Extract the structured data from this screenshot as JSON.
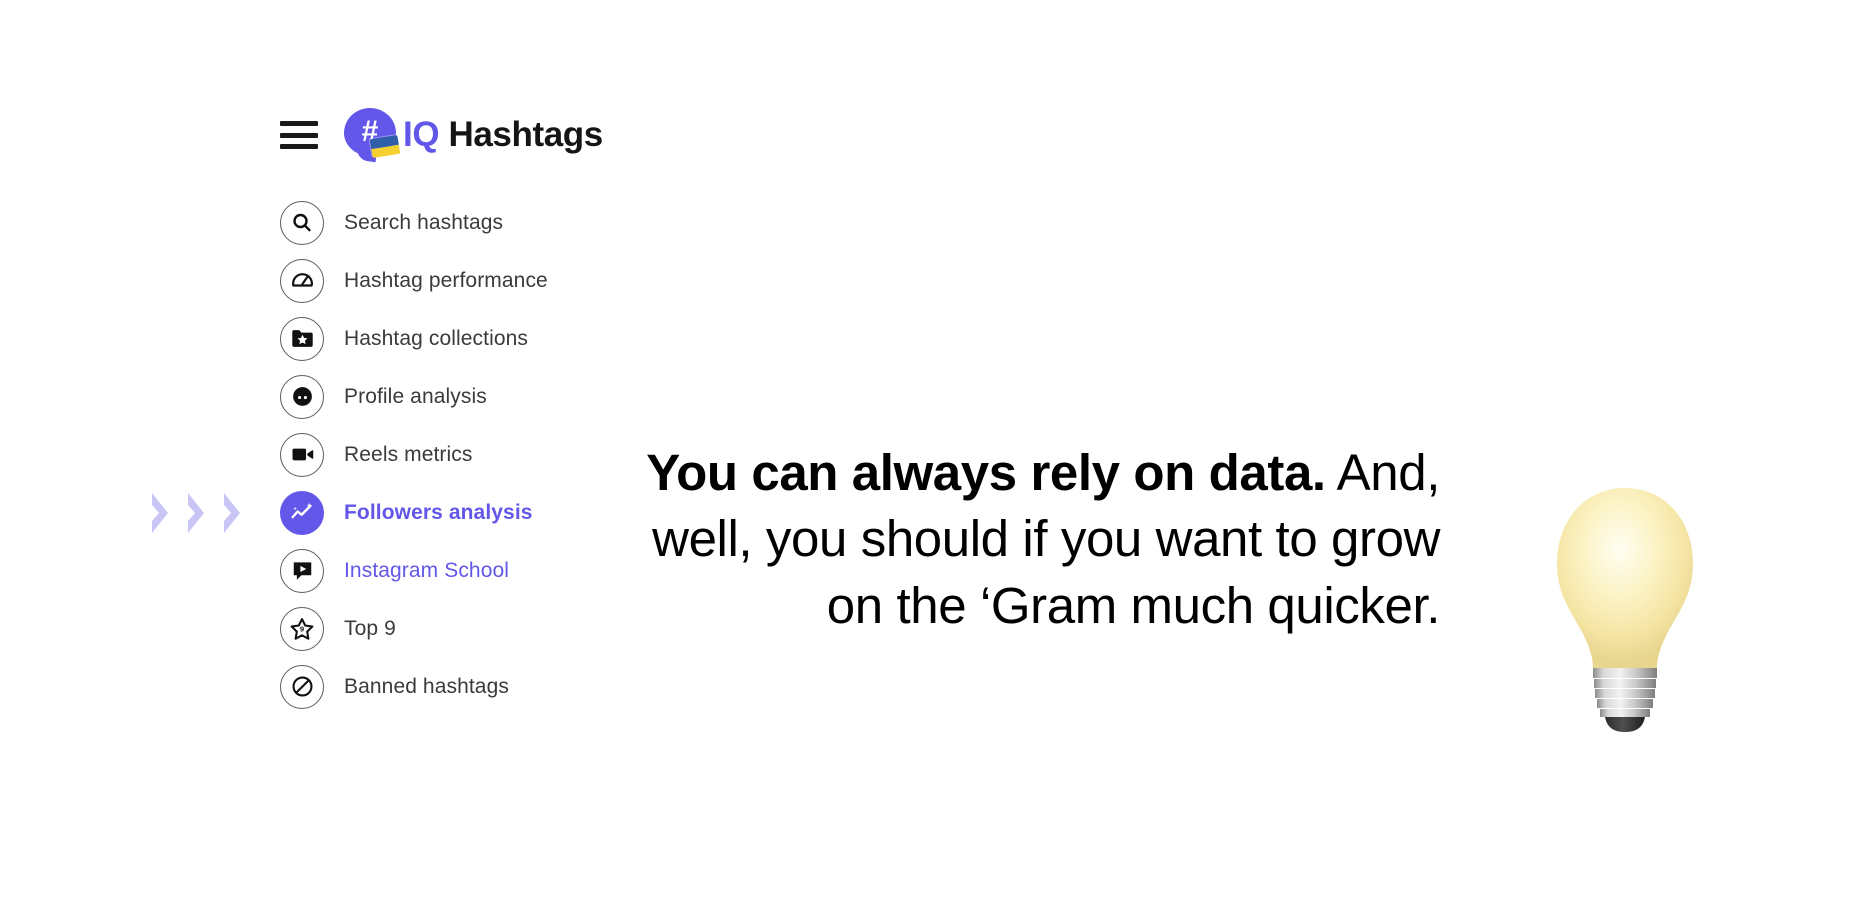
{
  "brand": {
    "menu_icon": "hamburger-menu-icon",
    "logo_icon": "hashtag-speech-bubble-logo",
    "flag_icon": "ukraine-flag-icon",
    "hash_symbol": "#",
    "name_accent": "IQ",
    "name_rest": " Hashtags",
    "accent_color": "#6257E8"
  },
  "sidebar": {
    "pointer_icon": "triple-chevron-right-icon",
    "items": [
      {
        "label": "Search hashtags",
        "icon": "search-icon",
        "state": "default"
      },
      {
        "label": "Hashtag performance",
        "icon": "speedometer-icon",
        "state": "default"
      },
      {
        "label": "Hashtag collections",
        "icon": "folder-star-icon",
        "state": "default"
      },
      {
        "label": "Profile analysis",
        "icon": "person-face-icon",
        "state": "default"
      },
      {
        "label": "Reels metrics",
        "icon": "video-camera-icon",
        "state": "default"
      },
      {
        "label": "Followers analysis",
        "icon": "trend-chart-sparkle-icon",
        "state": "active"
      },
      {
        "label": "Instagram School",
        "icon": "video-speech-bubble-icon",
        "state": "accent"
      },
      {
        "label": "Top 9",
        "icon": "star-nine-icon",
        "state": "default"
      },
      {
        "label": "Banned hashtags",
        "icon": "prohibited-icon",
        "state": "default"
      }
    ]
  },
  "message": {
    "line1": "You can always rely on data.",
    "line2": "And, well, you should if you want to grow on the ‘Gram much quicker."
  },
  "decoration": {
    "bulb_icon": "light-bulb-icon"
  }
}
